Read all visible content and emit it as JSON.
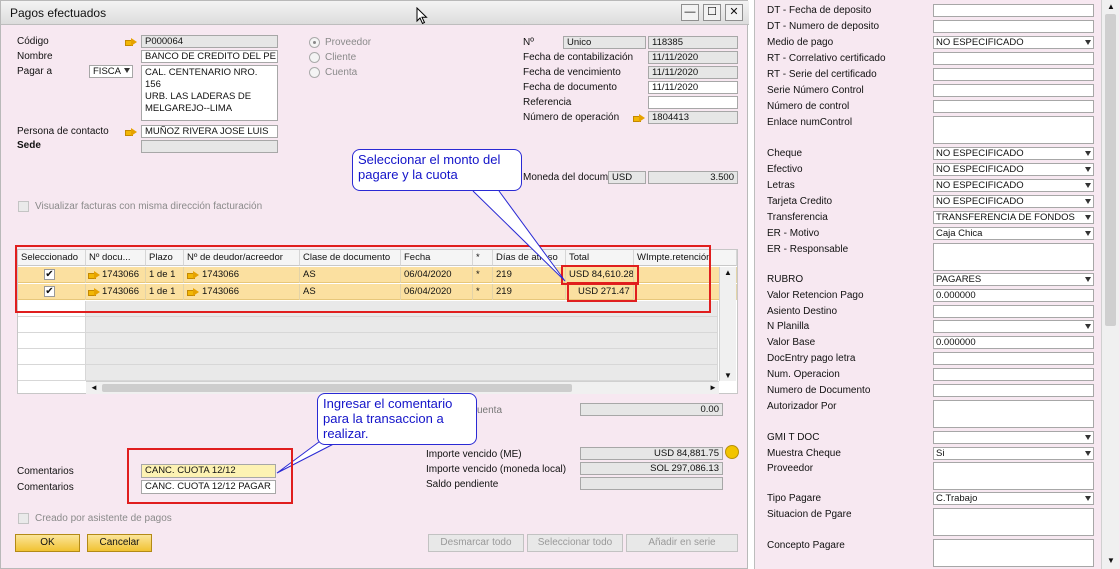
{
  "window": {
    "title": "Pagos efectuados",
    "min": "—",
    "max": "☐",
    "close": "✕"
  },
  "left": {
    "codigo_label": "Código",
    "codigo": "P000064",
    "nombre_label": "Nombre",
    "nombre": "BANCO DE CREDITO DEL PE",
    "pagar_a_label": "Pagar a",
    "pagar_a": "FISCA",
    "direccion_lines": [
      "CAL. CENTENARIO NRO. 156",
      "URB. LAS LADERAS DE",
      "MELGAREJO--LIMA"
    ],
    "contacto_label": "Persona de contacto",
    "contacto": "MUÑOZ RIVERA JOSE LUIS",
    "sede_label": "Sede",
    "radios": [
      "Proveedor",
      "Cliente",
      "Cuenta"
    ],
    "visualizar": "Visualizar facturas con misma dirección facturación"
  },
  "center": {
    "no_label": "Nº",
    "no_series": "Unico",
    "no_value": "118385",
    "fecha_cont_label": "Fecha de contabilización",
    "fecha_cont": "11/11/2020",
    "fecha_venc_label": "Fecha de vencimiento",
    "fecha_venc": "11/11/2020",
    "fecha_doc_label": "Fecha de documento",
    "fecha_doc": "11/11/2020",
    "referencia_label": "Referencia",
    "num_op_label": "Número de operación",
    "num_op": "1804413",
    "moneda_label": "Moneda del docum",
    "moneda": "USD",
    "tipo_cambio": "3.500"
  },
  "grid": {
    "headers": [
      "Seleccionado",
      "Nº docu...",
      "Plazo",
      "Nº de deudor/acreedor",
      "Clase de documento",
      "Fecha",
      "*",
      "Días de atraso",
      "Total",
      "WImpte.retención"
    ],
    "rows": [
      {
        "doc": "1743066",
        "plazo": "1 de 1",
        "deudor": "1743066",
        "clase": "AS",
        "fecha": "06/04/2020",
        "star": "*",
        "dias": "219",
        "total": "USD 84,610.28"
      },
      {
        "doc": "1743066",
        "plazo": "1 de 1",
        "deudor": "1743066",
        "clase": "AS",
        "fecha": "06/04/2020",
        "star": "*",
        "dias": "219",
        "total": "USD 271.47"
      }
    ],
    "check": "✔"
  },
  "bottom": {
    "cuenta_label": "uenta",
    "cuenta_value": "0.00",
    "comentarios_label": "Comentarios",
    "comentario1": "CANC. CUOTA 12/12",
    "comentario2": "CANC. CUOTA 12/12 PAGAR",
    "imp_me_label": "Importe vencido (ME)",
    "imp_me": "USD 84,881.75",
    "imp_ml_label": "Importe vencido (moneda local)",
    "imp_ml": "SOL 297,086.13",
    "saldo_label": "Saldo pendiente",
    "creado_label": "Creado por asistente de pagos",
    "ok": "OK",
    "cancelar": "Cancelar",
    "desmarcar": "Desmarcar todo",
    "seleccionar": "Seleccionar todo",
    "anadir": "Añadir en serie"
  },
  "callouts": {
    "monto": "Seleccionar el monto del pagare y la cuota",
    "comentario": "Ingresar el comentario para la transaccion a realizar."
  },
  "right_panel": {
    "fields": [
      {
        "label": "DT - Fecha de deposito",
        "value": "",
        "dd": false
      },
      {
        "label": "DT - Numero de deposito",
        "value": "",
        "dd": false
      },
      {
        "label": "Medio de pago",
        "value": "NO ESPECIFICADO",
        "dd": true
      },
      {
        "label": "RT - Correlativo certificado",
        "value": "",
        "dd": false
      },
      {
        "label": "RT - Serie del certificado",
        "value": "",
        "dd": false
      },
      {
        "label": "Serie Número Control",
        "value": "",
        "dd": false
      },
      {
        "label": "Número de control",
        "value": "",
        "dd": false
      },
      {
        "label": "Enlace numControl",
        "value": "",
        "dd": false,
        "tall": true
      },
      {
        "label": "Cheque",
        "value": "NO ESPECIFICADO",
        "dd": true
      },
      {
        "label": "Efectivo",
        "value": "NO ESPECIFICADO",
        "dd": true
      },
      {
        "label": "Letras",
        "value": "NO ESPECIFICADO",
        "dd": true
      },
      {
        "label": "Tarjeta Credito",
        "value": "NO ESPECIFICADO",
        "dd": true
      },
      {
        "label": "Transferencia",
        "value": "TRANSFERENCIA DE FONDOS",
        "dd": true
      },
      {
        "label": "ER - Motivo",
        "value": "Caja Chica",
        "dd": true
      },
      {
        "label": "ER - Responsable",
        "value": "",
        "dd": false,
        "tall": true
      },
      {
        "label": "RUBRO",
        "value": "PAGARES",
        "dd": true
      },
      {
        "label": "Valor Retencion Pago",
        "value": "0.000000",
        "dd": false
      },
      {
        "label": "Asiento Destino",
        "value": "",
        "dd": false
      },
      {
        "label": "N Planilla",
        "value": "",
        "dd": true
      },
      {
        "label": "Valor Base",
        "value": "0.000000",
        "dd": false
      },
      {
        "label": "DocEntry pago letra",
        "value": "",
        "dd": false
      },
      {
        "label": "Num. Operacion",
        "value": "",
        "dd": false
      },
      {
        "label": "Numero de Documento",
        "value": "",
        "dd": false
      },
      {
        "label": "Autorizador Por",
        "value": "",
        "dd": false,
        "tall": true
      },
      {
        "label": "GMI T DOC",
        "value": "",
        "dd": true
      },
      {
        "label": "Muestra Cheque",
        "value": "Si",
        "dd": true
      },
      {
        "label": "Proveedor",
        "value": "",
        "dd": false,
        "tall": true
      },
      {
        "label": "Tipo Pagare",
        "value": "C.Trabajo",
        "dd": true
      },
      {
        "label": "Situacion de Pgare",
        "value": "",
        "dd": false,
        "tall": true
      },
      {
        "label": "Concepto Pagare",
        "value": "",
        "dd": false,
        "tall": true
      }
    ],
    "scroll_up": "▲",
    "scroll_down": "▼"
  },
  "colors": {
    "window_bg": "#f7e8f1",
    "selected_row": "#fbe0a0",
    "highlight": "#e01e1e",
    "callout": "#1313c9"
  }
}
